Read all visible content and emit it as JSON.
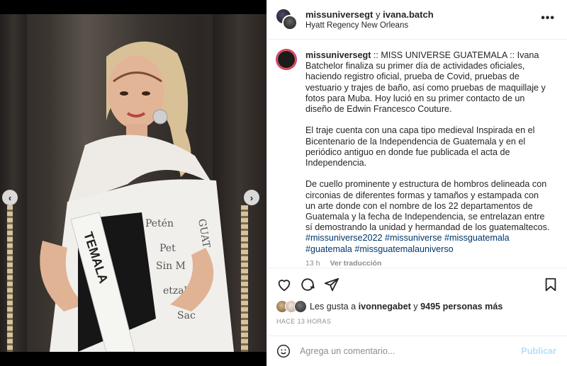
{
  "post": {
    "photo_alt_icon": "photo-of-woman-in-sash",
    "carousel": {
      "slides": 6,
      "active_index": 2
    }
  },
  "header": {
    "user1": "missuniversegt",
    "connector": " y ",
    "user2": "ivana.batch",
    "location": "Hyatt Regency New Orleans",
    "more_icon": "more-horizontal-icon"
  },
  "caption": {
    "username": "missuniversegt",
    "paragraph1": " :: MISS UNIVERSE GUATEMALA :: Ivana Batchelor finaliza su primer día de actividades oficiales, haciendo registro oficial, prueba de Covid, pruebas de vestuario y trajes de baño, así como pruebas de maquillaje y fotos para Muba. Hoy lució en su primer contacto de un diseño de Edwin Francesco Couture.",
    "paragraph2": "El traje cuenta con una capa tipo medieval Inspirada en el Bicentenario de la Independencia de Guatemala y en el periódico antiguo en donde fue publicada el acta de Independencia.",
    "paragraph3": "De cuello prominente y estructura de hombros delineada con circonias de diferentes formas y tamaños y estampada con un arte donde con el nombre de los 22 departamentos de Guatemala y la fecha de Independencia, se entrelazan entre sí demostrando la unidad y hermandad de los guatemaltecos.",
    "hashtags": "#missuniverse2022 #missuniverse #missguatemala #guatemala #missguatemalauniverso",
    "time_ago": "13 h",
    "see_translation": "Ver traducción"
  },
  "actions": {
    "like_icon": "heart-icon",
    "comment_icon": "comment-icon",
    "share_icon": "paper-plane-icon",
    "save_icon": "bookmark-icon"
  },
  "likes": {
    "prefix": "Les gusta a ",
    "liker": "ivonnegabet",
    "middle": " y ",
    "count": "9495 personas más"
  },
  "timestamp": "HACE 13 HORAS",
  "comment_box": {
    "placeholder": "Agrega un comentario...",
    "publish_label": "Publicar"
  },
  "colors": {
    "link_blue": "#00376b",
    "publish_disabled": "#b2dffc",
    "muted": "#8e8e8e",
    "carousel_active": "#3a95f0"
  }
}
